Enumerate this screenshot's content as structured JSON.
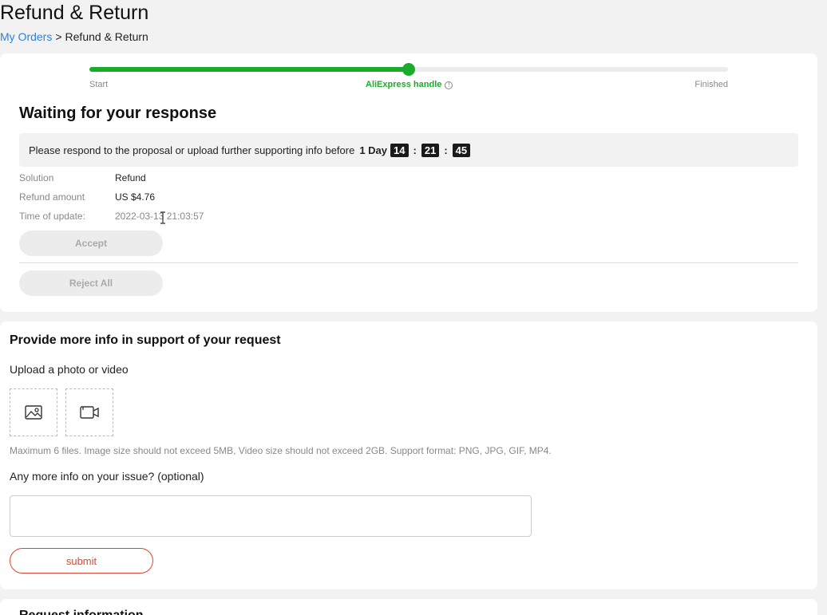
{
  "page": {
    "title": "Refund & Return",
    "breadcrumb": {
      "parent": "My Orders",
      "separator": ">",
      "current": "Refund & Return"
    }
  },
  "progress": {
    "steps": [
      "Start",
      "AliExpress handle",
      "Finished"
    ],
    "current_step": 1,
    "fraction": 0.5,
    "accent_color": "#1bab2a"
  },
  "status": {
    "title": "Waiting for your response",
    "notice_text": "Please respond to the proposal or upload further supporting info before",
    "countdown": {
      "days": "1 Day",
      "hours": "14",
      "minutes": "21",
      "seconds": "45",
      "separator": ":"
    }
  },
  "details": [
    {
      "key": "Solution",
      "value": "Refund"
    },
    {
      "key": "Refund amount",
      "value": "US $4.76"
    },
    {
      "key": "Time of update:",
      "value": "2022-03-13 21:03:57"
    }
  ],
  "actions": {
    "accept": "Accept",
    "reject_all": "Reject All"
  },
  "support": {
    "title": "Provide more info in support of your request",
    "upload_label": "Upload a photo or video",
    "photo_icon": "image-icon",
    "video_icon": "video-icon",
    "hint": "Maximum 6 files. Image size should not exceed 5MB, Video size should not exceed 2GB. Support format: PNG, JPG, GIF, MP4.",
    "more_info_label": "Any more info on your issue? (optional)",
    "textarea_value": "",
    "submit": "submit",
    "submit_color": "#d9482f"
  },
  "request_info": {
    "title": "Request information"
  }
}
